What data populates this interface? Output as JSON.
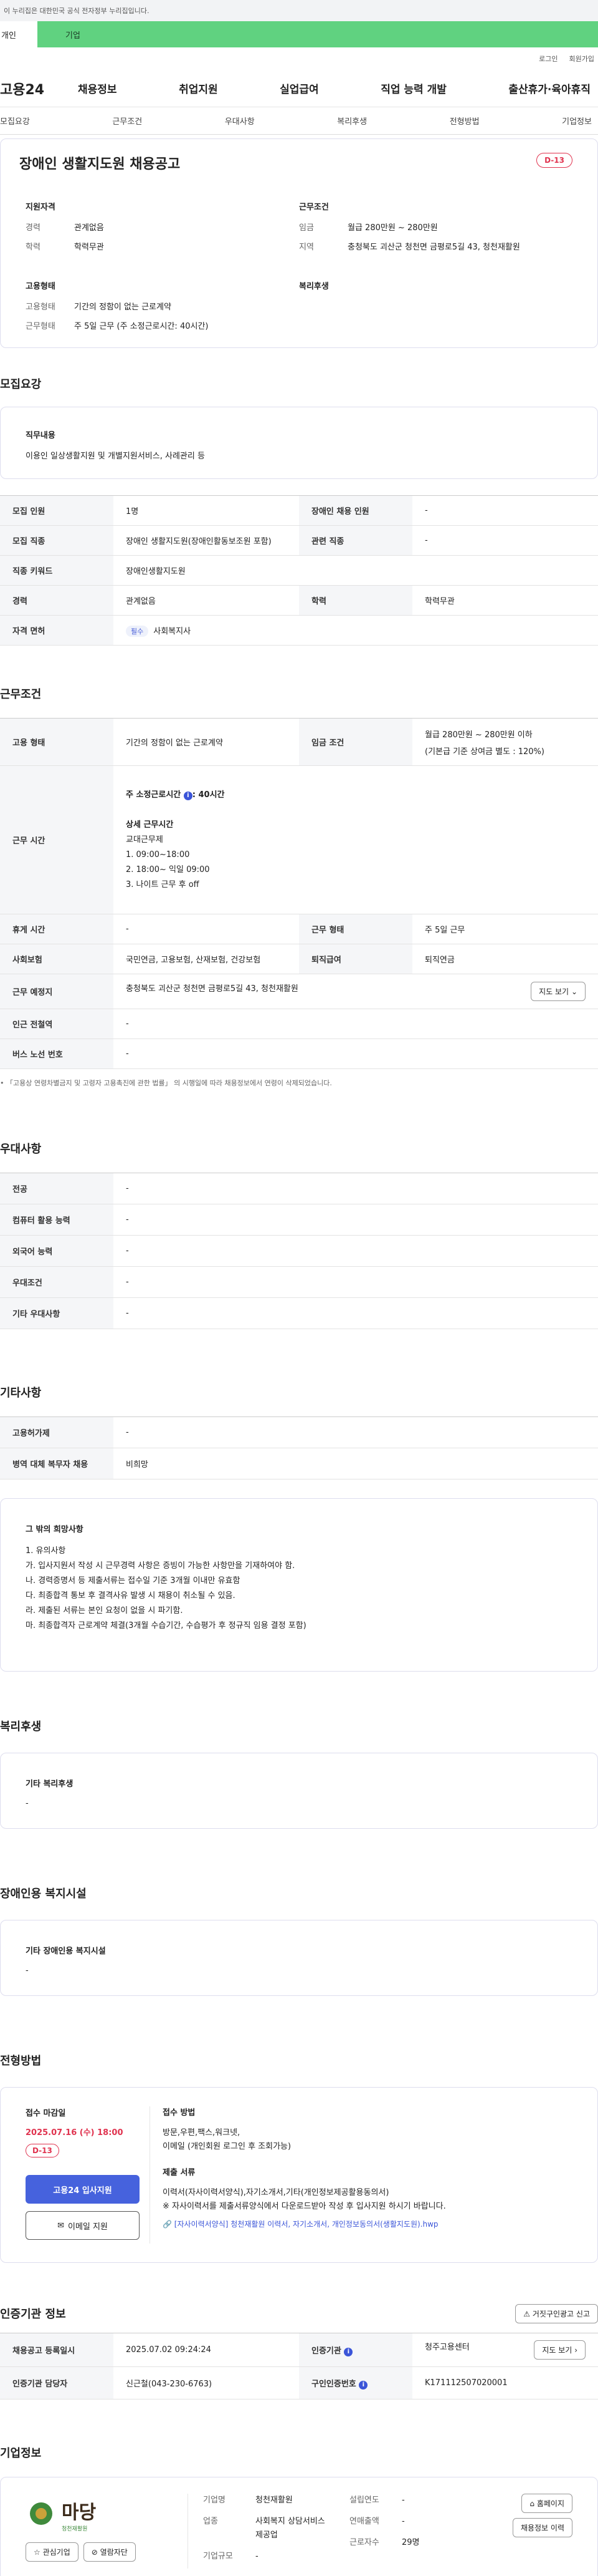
{
  "topbar": {
    "notice": "이 누리집은 대한민국 공식 전자정부 누리집입니다."
  },
  "tabs": {
    "personal": "개인",
    "enterprise": "기업"
  },
  "util": {
    "login": "로그인",
    "join": "회원가입"
  },
  "gnb": {
    "logo": "고용24",
    "menu": [
      "채용정보",
      "취업지원",
      "실업급여",
      "직업 능력 개발",
      "출산휴가·육아휴직"
    ]
  },
  "subnav": [
    "모집요강",
    "근무조건",
    "우대사항",
    "복리후생",
    "전형방법",
    "기업정보"
  ],
  "summary": {
    "title": "장애인 생활지도원 채용공고",
    "dday": "D-13",
    "qual_title": "지원자격",
    "qual": [
      {
        "k": "경력",
        "v": "관계없음"
      },
      {
        "k": "학력",
        "v": "학력무관"
      }
    ],
    "cond_title": "근무조건",
    "cond": [
      {
        "k": "임금",
        "v": "월급 280만원 ~ 280만원"
      },
      {
        "k": "지역",
        "v": "충청북도 괴산군 청천면 금평로5길 43, 청천재활원"
      }
    ],
    "emp_title": "고용형태",
    "emp": [
      {
        "k": "고용형태",
        "v": "기간의 정함이 없는 근로계약"
      },
      {
        "k": "근무형태",
        "v": "주 5일 근무 (주 소정근로시간: 40시간)"
      }
    ],
    "welfare_title": "복리후생"
  },
  "recruit": {
    "title": "모집요강",
    "duty_label": "직무내용",
    "duty": "이용인 일상생활지원 및 개별지원서비스, 사례관리 등",
    "rows": [
      {
        "k1": "모집 인원",
        "v1": "1명",
        "k2": "장애인 채용 인원",
        "v2": "-"
      },
      {
        "k1": "모집 직종",
        "v1": "장애인 생활지도원(장애인활동보조원 포함)",
        "k2": "관련 직종",
        "v2": "-"
      },
      {
        "k1": "직종 키워드",
        "v1": "장애인생활지도원"
      },
      {
        "k1": "경력",
        "v1": "관계없음",
        "k2": "학력",
        "v2": "학력무관"
      },
      {
        "k1": "자격 면허",
        "pill": "필수",
        "v1": "사회복지사"
      }
    ]
  },
  "work": {
    "title": "근무조건",
    "emp_k": "고용 형태",
    "emp_v": "기간의 정함이 없는 근로계약",
    "wage_k": "임금 조건",
    "wage_v1": "월급 280만원 ~ 280만원 이하",
    "wage_v2": "(기본급 기준 상여금 별도 : 120%)",
    "hours_k": "근무 시간",
    "hours_head": "주 소정근로시간",
    "hours_val": ": 40시간",
    "hours_detail_title": "상세 근무시간",
    "hours_lines": [
      "교대근무제",
      "1. 09:00~18:00",
      "2. 18:00~ 익일 09:00",
      "3. 나이트 근무 후 off"
    ],
    "rest_k": "휴게 시간",
    "rest_v": "-",
    "form_k": "근무 형태",
    "form_v": "주 5일 근무",
    "ins_k": "사회보험",
    "ins_v": "국민연금, 고용보험, 산재보험, 건강보험",
    "ret_k": "퇴직급여",
    "ret_v": "퇴직연금",
    "place_k": "근무 예정지",
    "place_v": "충청북도 괴산군 청천면 금평로5길 43, 청천재활원",
    "map_btn": "지도 보기",
    "station_k": "인근 전철역",
    "station_v": "-",
    "bus_k": "버스 노선 번호",
    "bus_v": "-",
    "footnote": "「고용상 연령차별금지 및 고령자 고용촉진에 관한 법률」 의 시행일에 따라 채용정보에서 연령이 삭제되었습니다."
  },
  "pref": {
    "title": "우대사항",
    "rows": [
      {
        "k": "전공",
        "v": "-"
      },
      {
        "k": "컴퓨터 활용 능력",
        "v": "-"
      },
      {
        "k": "외국어 능력",
        "v": "-"
      },
      {
        "k": "우대조건",
        "v": "-"
      },
      {
        "k": "기타 우대사항",
        "v": "-"
      }
    ]
  },
  "etc": {
    "title": "기타사항",
    "rows": [
      {
        "k": "고용허가제",
        "v": "-"
      },
      {
        "k": "병역 대체 복무자 채용",
        "v": "비희망"
      }
    ],
    "req_title": "그 밖의 희망사항",
    "req_lines": [
      "1. 유의사항",
      "가. 입사지원서 작성 시 근무경력 사항은 증빙이 가능한 사항만을 기재하여야 함.",
      "나. 경력증명서 등 제출서류는 접수일 기준 3개월 이내만 유효함",
      "다. 최종합격 통보 후 결격사유 발생 시 채용이 취소될 수 있음.",
      "라. 제출된 서류는 본인 요청이 없을 시 파기함.",
      "마. 최종합격자 근로계약 체결(3개월 수습기간, 수습평가 후 정규직 임용 결정 포함)"
    ]
  },
  "welfare": {
    "title": "복리후생",
    "box_title": "기타 복리후생",
    "box_v": "-"
  },
  "facility": {
    "title": "장애인용 복지시설",
    "box_title": "기타 장애인용 복지시설",
    "box_v": "-"
  },
  "process": {
    "title": "전형방법",
    "deadline_label": "접수 마감일",
    "deadline": "2025.07.16 (수) 18:00",
    "dday": "D-13",
    "apply_btn": "고용24 입사지원",
    "email_btn": "이메일 지원",
    "method_label": "접수 방법",
    "methods": [
      "방문,우편,팩스,워크넷,",
      "이메일 (개인회원 로그인 후 조회가능)"
    ],
    "docs_label": "제출 서류",
    "docs_1": "이력서(자사이력서양식),자기소개서,기타(개인정보제공활용동의서)",
    "docs_2": "※ 자사이력서를 제출서류양식에서 다운로드받아 작성 후 입사지원 하시기 바랍니다.",
    "file": "[자사이력서양식] 청천재활원 이력서, 자기소개서, 개인정보동의서(생활지도원).hwp"
  },
  "cert": {
    "title": "인증기관 정보",
    "report_btn": "거짓구인광고 신고",
    "r1": {
      "k1": "채용공고 등록일시",
      "v1": "2025.07.02 09:24:24",
      "k2": "인증기관",
      "v2": "청주고용센터",
      "btn": "지도 보기"
    },
    "r2": {
      "k1": "인증기관 담당자",
      "v1": "신근철(043-230-6763)",
      "k2": "구인인증번호",
      "v2": "K171112507020001"
    }
  },
  "company": {
    "title": "기업정보",
    "logo_text": "마당",
    "logo_sub": "청천재활원",
    "interest_btn": "관심기업",
    "follow_btn": "열람자단",
    "fields": [
      {
        "k": "기업명",
        "v": "청천재활원"
      },
      {
        "k": "업종",
        "v": "사회복지 상담서비스 제공업"
      },
      {
        "k": "기업규모",
        "v": "-"
      }
    ],
    "fields2": [
      {
        "k": "설립연도",
        "v": "-"
      },
      {
        "k": "연매출액",
        "v": "-"
      },
      {
        "k": "근로자수",
        "v": "29명"
      }
    ],
    "homepage_btn": "홈페이지",
    "jobs_btn": "채용정보 이력"
  }
}
